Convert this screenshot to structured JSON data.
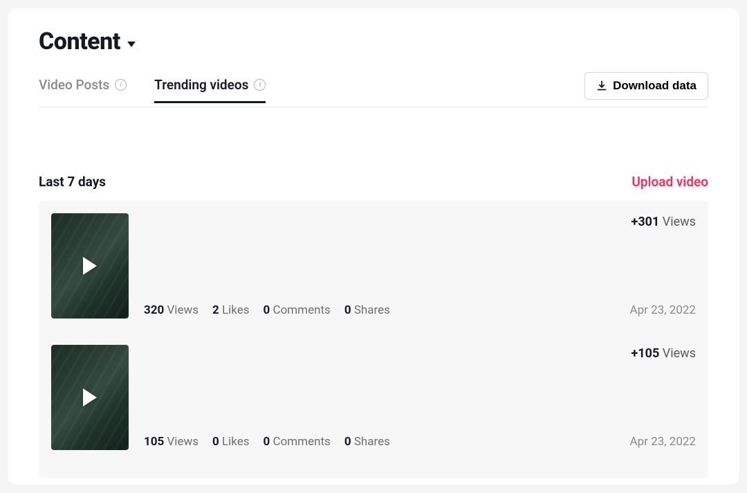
{
  "header": {
    "title": "Content"
  },
  "tabs": [
    {
      "label": "Video Posts",
      "active": false
    },
    {
      "label": "Trending videos",
      "active": true
    }
  ],
  "actions": {
    "download_label": "Download data",
    "upload_label": "Upload video"
  },
  "section": {
    "title": "Last 7 days"
  },
  "labels": {
    "views": "Views",
    "likes": "Likes",
    "comments": "Comments",
    "shares": "Shares"
  },
  "videos": [
    {
      "views": "320",
      "likes": "2",
      "comments": "0",
      "shares": "0",
      "delta_views": "+301",
      "date": "Apr 23, 2022"
    },
    {
      "views": "105",
      "likes": "0",
      "comments": "0",
      "shares": "0",
      "delta_views": "+105",
      "date": "Apr 23, 2022"
    }
  ]
}
